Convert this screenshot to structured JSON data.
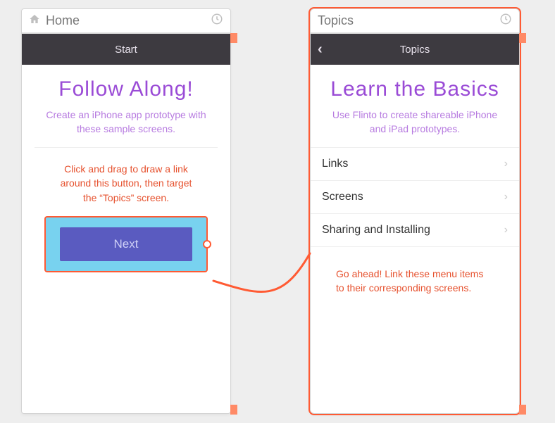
{
  "home": {
    "title": "Home",
    "navTitle": "Start",
    "heading": "Follow Along!",
    "sub": "Create an iPhone app prototype with these sample screens.",
    "hint": "Click and drag to draw a link around this button, then target the “Topics” screen.",
    "nextLabel": "Next"
  },
  "topics": {
    "title": "Topics",
    "navTitle": "Topics",
    "heading": "Learn the Basics",
    "sub": "Use Flinto to create shareable iPhone and iPad prototypes.",
    "rows": [
      {
        "label": "Links"
      },
      {
        "label": "Screens"
      },
      {
        "label": "Sharing and Installing"
      }
    ],
    "hint": "Go ahead! Link these menu items to their corresponding screens."
  }
}
